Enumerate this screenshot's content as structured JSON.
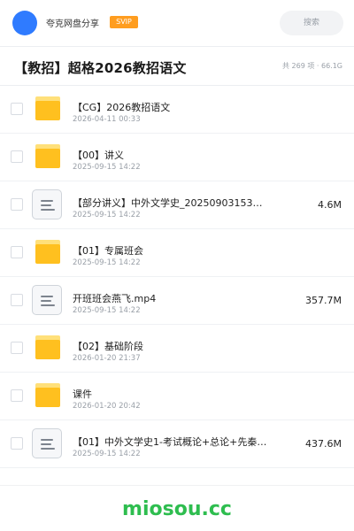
{
  "topbar": {
    "user_name": "夸克网盘分享",
    "badge": "SVIP",
    "search_placeholder": "搜索"
  },
  "header": {
    "title": "【教招】超格2026教招语文",
    "meta": "共 269 项 · 66.1G"
  },
  "files": [
    {
      "type": "folder",
      "name": "【CG】2026教招语文",
      "date": "2026-04-11 00:33",
      "size": ""
    },
    {
      "type": "folder",
      "name": "【00】讲义",
      "date": "2025-09-15 14:22",
      "size": ""
    },
    {
      "type": "doc",
      "name": "【部分讲义】中外文学史_2025090315360…",
      "date": "2025-09-15 14:22",
      "size": "4.6M"
    },
    {
      "type": "folder",
      "name": "【01】专属班会",
      "date": "2025-09-15 14:22",
      "size": ""
    },
    {
      "type": "doc",
      "name": "开班班会燕飞.mp4",
      "date": "2025-09-15 14:22",
      "size": "357.7M"
    },
    {
      "type": "folder",
      "name": "【02】基础阶段",
      "date": "2026-01-20 21:37",
      "size": ""
    },
    {
      "type": "folder",
      "name": "课件",
      "date": "2026-01-20 20:42",
      "size": ""
    },
    {
      "type": "doc",
      "name": "【01】中外文学史1-考试概论+总论+先秦文学1娜…",
      "date": "2025-09-15 14:22",
      "size": "437.6M"
    }
  ],
  "footer": {
    "watermark": "miosou.cc"
  },
  "colors": {
    "avatar": "#2f7bff",
    "svip": "#ff9d1f",
    "folder": "#ffc01f",
    "watermark": "#2ebd4f"
  }
}
